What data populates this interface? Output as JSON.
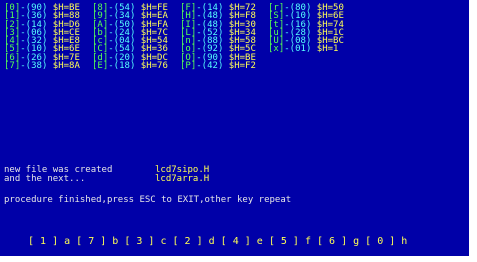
{
  "table": {
    "rows": [
      [
        {
          "k": "[0]",
          "v": "-(90)",
          "h": "$H=BE"
        },
        {
          "k": "[8]",
          "v": "-(54)",
          "h": "$H=FE"
        },
        {
          "k": "[F]",
          "v": "-(14)",
          "h": "$H=72"
        },
        {
          "k": "[r]",
          "v": "-(80)",
          "h": "$H=50"
        }
      ],
      [
        {
          "k": "[1]",
          "v": "-(36)",
          "h": "$H=88"
        },
        {
          "k": "[9]",
          "v": "-(34)",
          "h": "$H=EA"
        },
        {
          "k": "[H]",
          "v": "-(48)",
          "h": "$H=F8"
        },
        {
          "k": "[S]",
          "v": "-(10)",
          "h": "$H=6E"
        }
      ],
      [
        {
          "k": "[2]",
          "v": "-(14)",
          "h": "$H=D6"
        },
        {
          "k": "[A]",
          "v": "-(50)",
          "h": "$H=FA"
        },
        {
          "k": "[I]",
          "v": "-(48)",
          "h": "$H=30"
        },
        {
          "k": "[t]",
          "v": "-(16)",
          "h": "$H=74"
        }
      ],
      [
        {
          "k": "[3]",
          "v": "-(06)",
          "h": "$H=CE"
        },
        {
          "k": "[b]",
          "v": "-(24)",
          "h": "$H=7C"
        },
        {
          "k": "[L]",
          "v": "-(52)",
          "h": "$H=34"
        },
        {
          "k": "[u]",
          "v": "-(28)",
          "h": "$H=1C"
        }
      ],
      [
        {
          "k": "[4]",
          "v": "-(32)",
          "h": "$H=E8"
        },
        {
          "k": "[c]",
          "v": "-(04)",
          "h": "$H=54"
        },
        {
          "k": "[n]",
          "v": "-(88)",
          "h": "$H=58"
        },
        {
          "k": "[U]",
          "v": "-(08)",
          "h": "$H=BC"
        }
      ],
      [
        {
          "k": "[5]",
          "v": "-(10)",
          "h": "$H=6E"
        },
        {
          "k": "[C]",
          "v": "-(54)",
          "h": "$H=36"
        },
        {
          "k": "[o]",
          "v": "-(92)",
          "h": "$H=5C"
        },
        {
          "k": "[x]",
          "v": "-(01)",
          "h": "$H=1"
        }
      ],
      [
        {
          "k": "[6]",
          "v": "-(26)",
          "h": "$H=7E"
        },
        {
          "k": "[d]",
          "v": "-(20)",
          "h": "$H=DC"
        },
        {
          "k": "[O]",
          "v": "-(90)",
          "h": "$H=BE"
        },
        null
      ],
      [
        {
          "k": "[7]",
          "v": "-(38)",
          "h": "$H=8A"
        },
        {
          "k": "[E]",
          "v": "-(18)",
          "h": "$H=76"
        },
        {
          "k": "[P]",
          "v": "-(42)",
          "h": "$H=F2"
        },
        null
      ]
    ]
  },
  "messages": {
    "line1_label": "new file was created",
    "line1_file": "lcd7sipo.H",
    "line2_label": "and the next...",
    "line2_file": "lcd7arra.H",
    "prompt": "procedure finished,press ESC to EXIT,other key repeat"
  },
  "segment_map": "[ 1 ] a [ 7 ] b [ 3 ] c [ 2 ] d [ 4 ] e [ 5 ] f [ 6 ] g [ 0 ] h",
  "colors": {
    "background": "#0000a8",
    "key": "#55ff55",
    "value": "#55ffff",
    "hex": "#ffff55",
    "text": "#e6e6e6",
    "filename": "#ffff55"
  }
}
